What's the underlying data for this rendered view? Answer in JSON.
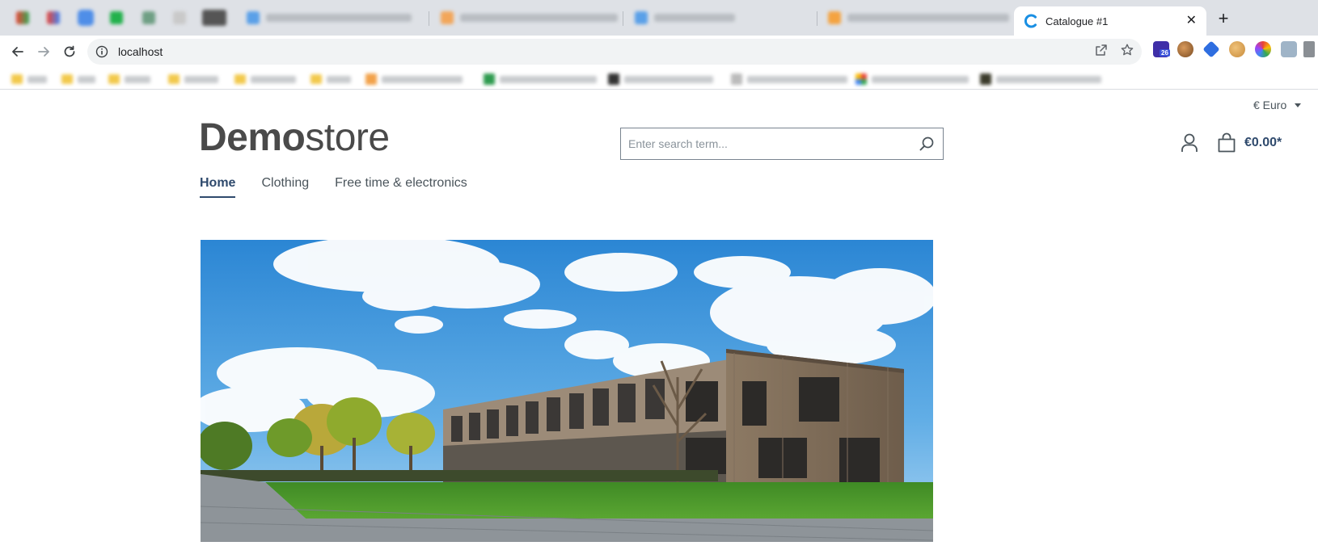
{
  "browser": {
    "active_tab": {
      "title": "Catalogue #1"
    },
    "url": "localhost",
    "new_tab_label": "+",
    "close_label": "✕"
  },
  "store": {
    "currency_label": "€ Euro",
    "logo_bold": "Demo",
    "logo_light": "store",
    "search": {
      "placeholder": "Enter search term..."
    },
    "cart_total": "€0.00*",
    "nav": [
      {
        "label": "Home"
      },
      {
        "label": "Clothing"
      },
      {
        "label": "Free time & electronics"
      }
    ]
  },
  "extensions": {
    "badge": "26"
  },
  "colors": {
    "primary": "#2f4a6d",
    "text": "#4a545b",
    "sky": "#4e9fdf",
    "lawn": "#4c8f2c"
  },
  "icons": {
    "search": "search-icon",
    "account": "user-icon",
    "cart": "shopping-bag-icon"
  }
}
